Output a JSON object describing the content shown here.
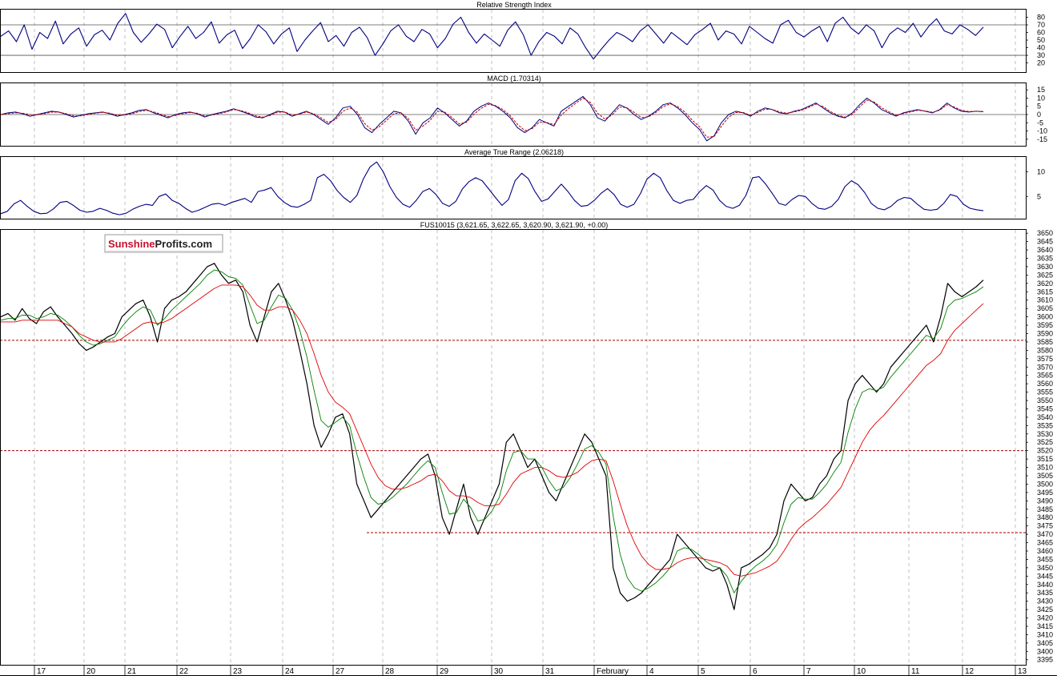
{
  "logo": {
    "part1": "Sunshine",
    "part2": "Profits.com"
  },
  "colors": {
    "rsi": "#000080",
    "macd": "#000080",
    "macd_signal": "#c00000",
    "atr": "#000080",
    "price": "#000000",
    "ma_short": "#008000",
    "ma_long": "#e00000",
    "level": "#a00000",
    "grid": "#bfbfbf",
    "frame": "#000000"
  },
  "chart_data": [
    {
      "type": "line",
      "title": "Relative Strength Index",
      "ylim": [
        8,
        90
      ],
      "yticks": [
        80,
        70,
        60,
        50,
        40,
        30,
        20
      ],
      "reference_lines": [
        70,
        30
      ],
      "series": [
        {
          "values": [
            55,
            62,
            48,
            70,
            38,
            60,
            52,
            75,
            45,
            58,
            66,
            42,
            57,
            63,
            50,
            72,
            85,
            60,
            47,
            58,
            71,
            64,
            40,
            55,
            68,
            52,
            60,
            74,
            46,
            57,
            63,
            39,
            52,
            70,
            61,
            45,
            58,
            66,
            35,
            50,
            62,
            73,
            48,
            56,
            42,
            60,
            67,
            53,
            30,
            45,
            62,
            70,
            55,
            48,
            64,
            58,
            40,
            52,
            71,
            80,
            60,
            46,
            58,
            50,
            42,
            63,
            74,
            57,
            30,
            48,
            60,
            55,
            45,
            66,
            58,
            40,
            25,
            38,
            50,
            60,
            55,
            48,
            62,
            70,
            58,
            46,
            60,
            52,
            44,
            57,
            64,
            72,
            50,
            62,
            58,
            45,
            68,
            60,
            52,
            46,
            70,
            76,
            60,
            54,
            62,
            68,
            48,
            72,
            80,
            66,
            58,
            70,
            62,
            40,
            58,
            66,
            60,
            72,
            54,
            68,
            78,
            62,
            58,
            70,
            64,
            56,
            67
          ]
        }
      ]
    },
    {
      "type": "line",
      "title": "MACD (1.70314)",
      "ylim": [
        -19,
        19
      ],
      "yticks": [
        15,
        10,
        5,
        0,
        -5,
        -10,
        -15
      ],
      "series": [
        {
          "values": [
            0,
            1,
            1.5,
            0.5,
            -1,
            0,
            1,
            2,
            1.5,
            0,
            -1.5,
            -0.5,
            0.5,
            1,
            1.5,
            0.5,
            -1,
            0,
            1,
            2.5,
            3,
            1,
            -0.5,
            -2,
            0,
            1,
            1.5,
            0.5,
            -1.5,
            0,
            1,
            2,
            3.5,
            2,
            0.5,
            -1.5,
            -2,
            0,
            2,
            1.5,
            -1,
            0.5,
            2,
            0,
            -3,
            -6,
            -2,
            4,
            5,
            0,
            -8,
            -11,
            -6,
            -2,
            2,
            1,
            -4,
            -12,
            -5,
            -2,
            4,
            1,
            -3,
            -7,
            -4,
            2,
            5,
            7,
            5,
            2,
            -2,
            -8,
            -11,
            -8,
            -3,
            -5,
            -7,
            2,
            5,
            8,
            11,
            6,
            -2,
            -4,
            1,
            6,
            4,
            0,
            -3,
            -1,
            2,
            6,
            7,
            4,
            0,
            -5,
            -9,
            -16,
            -13,
            -5,
            0,
            2,
            1,
            -1,
            2,
            4,
            3,
            1,
            0.5,
            2,
            3,
            5,
            7,
            4,
            1,
            -1,
            -2,
            1,
            6,
            10,
            7,
            3,
            1,
            -1,
            1,
            2,
            3,
            2,
            1,
            3,
            7,
            4,
            2,
            1.5,
            2,
            1.7
          ]
        },
        {
          "values": [
            0,
            0.5,
            1,
            0.8,
            0,
            -0.2,
            0.5,
            1.5,
            1.4,
            0.5,
            -0.8,
            -0.8,
            0,
            0.8,
            1.3,
            0.8,
            -0.4,
            -0.4,
            0.5,
            1.8,
            2.6,
            1.6,
            0.2,
            -1.2,
            -0.6,
            0.5,
            1.2,
            0.8,
            -0.8,
            -0.4,
            0.6,
            1.6,
            3,
            2.4,
            1,
            -0.8,
            -1.6,
            -0.6,
            1.4,
            1.5,
            -0.2,
            0.2,
            1.5,
            0.5,
            -2,
            -4.8,
            -3,
            2,
            4,
            1.4,
            -5.5,
            -9.5,
            -7.5,
            -3.5,
            0.5,
            1,
            -2.5,
            -9.5,
            -7,
            -3.5,
            2,
            1.4,
            -1.8,
            -5.8,
            -4.6,
            0.2,
            3.8,
            6.2,
            5.4,
            3,
            -0.8,
            -6,
            -9.8,
            -8.6,
            -4.6,
            -4.8,
            -6.2,
            -0.4,
            3.6,
            6.8,
            10,
            7.4,
            0.8,
            -2.8,
            -0.2,
            4.6,
            4.2,
            1.4,
            -1.8,
            -1.4,
            1.2,
            4.8,
            6.5,
            4.8,
            1.4,
            -3.4,
            -7.4,
            -13.8,
            -13.4,
            -7.2,
            -1.6,
            1.2,
            1.2,
            -0.4,
            1.2,
            3.2,
            3.1,
            1.6,
            0.8,
            1.6,
            2.6,
            4.4,
            6.4,
            4.8,
            1.8,
            -0.4,
            -1.6,
            0,
            4.6,
            8.8,
            7.6,
            4.2,
            1.8,
            -0.4,
            0.6,
            1.6,
            2.6,
            2.2,
            1.4,
            2.6,
            6,
            4.6,
            2.6,
            1.8,
            2,
            1.8
          ]
        }
      ]
    },
    {
      "type": "line",
      "title": "Average True Range (2.06218)",
      "ylim": [
        0.5,
        13
      ],
      "yticks": [
        10,
        5
      ],
      "series": [
        {
          "values": [
            1.5,
            2,
            3.5,
            4.2,
            3,
            2,
            1.5,
            1.6,
            2.5,
            3.8,
            4,
            3.2,
            2.2,
            1.8,
            2,
            2.6,
            2.2,
            1.6,
            1.3,
            1.6,
            2.4,
            3,
            3.4,
            3.2,
            5,
            5.5,
            4.2,
            3.6,
            2.6,
            1.8,
            2.2,
            2.8,
            3.4,
            3.6,
            3.2,
            3.8,
            4.2,
            4.6,
            3.8,
            6,
            6.3,
            6.8,
            5,
            3.8,
            3,
            2.8,
            3.4,
            4.2,
            8.8,
            9.5,
            8.2,
            6.2,
            4.8,
            3.8,
            5.2,
            8.6,
            11,
            12,
            10,
            7,
            4.8,
            3.4,
            2.8,
            4.2,
            6,
            6.6,
            5.4,
            3.6,
            3,
            4,
            6.5,
            8,
            8.8,
            8.2,
            6.5,
            4.8,
            3.2,
            4.4,
            8.2,
            9.7,
            8.6,
            6,
            4,
            4.5,
            6,
            7.5,
            6,
            4.2,
            3,
            3.2,
            4.2,
            5.6,
            6.6,
            5.4,
            3.4,
            2.8,
            3.4,
            5.6,
            8.5,
            9.7,
            8.8,
            6.2,
            4.2,
            3.6,
            4.2,
            4.4,
            6,
            7.2,
            6.3,
            4.2,
            3,
            2.6,
            3.2,
            5.2,
            8.8,
            9,
            7.5,
            5.6,
            3.6,
            3.2,
            4.4,
            5.2,
            5,
            3.6,
            2.6,
            2.4,
            3,
            4.4,
            7,
            8.2,
            7.4,
            5.8,
            3.6,
            2.6,
            2.3,
            3,
            4.2,
            4.8,
            4.6,
            3.4,
            2.4,
            2.2,
            2.4,
            3.6,
            5.4,
            5,
            3.4,
            2.6,
            2.3,
            2.1
          ]
        }
      ]
    },
    {
      "type": "line",
      "title": "FUS10015 (3,621.65, 3,622.65, 3,620.90, 3,621.90, +0.00)",
      "ylim": [
        3392,
        3652
      ],
      "yticks": [
        3650,
        3645,
        3640,
        3635,
        3630,
        3625,
        3620,
        3615,
        3610,
        3605,
        3600,
        3595,
        3590,
        3585,
        3580,
        3575,
        3570,
        3565,
        3560,
        3555,
        3550,
        3545,
        3540,
        3535,
        3530,
        3525,
        3520,
        3515,
        3510,
        3505,
        3500,
        3495,
        3490,
        3485,
        3480,
        3475,
        3470,
        3465,
        3460,
        3455,
        3450,
        3445,
        3440,
        3435,
        3430,
        3425,
        3420,
        3415,
        3410,
        3405,
        3400,
        3395
      ],
      "reference_lines": [
        3586,
        3520,
        3471
      ],
      "x_labels": [
        "17",
        "20",
        "21",
        "22",
        "23",
        "24",
        "27",
        "28",
        "29",
        "30",
        "31",
        "February",
        "4",
        "5",
        "6",
        "7",
        "10",
        "11",
        "12",
        "13"
      ],
      "series": [
        {
          "values": [
            3600,
            3602,
            3598,
            3605,
            3599,
            3596,
            3603,
            3606,
            3600,
            3595,
            3590,
            3584,
            3580,
            3582,
            3585,
            3588,
            3590,
            3600,
            3604,
            3608,
            3610,
            3600,
            3585,
            3605,
            3610,
            3612,
            3615,
            3620,
            3625,
            3630,
            3632,
            3625,
            3620,
            3622,
            3615,
            3595,
            3585,
            3600,
            3615,
            3620,
            3610,
            3598,
            3580,
            3560,
            3535,
            3522,
            3530,
            3540,
            3542,
            3530,
            3500,
            3490,
            3480,
            3485,
            3490,
            3495,
            3500,
            3505,
            3510,
            3515,
            3518,
            3505,
            3480,
            3470,
            3485,
            3500,
            3480,
            3470,
            3480,
            3490,
            3500,
            3525,
            3530,
            3520,
            3510,
            3515,
            3505,
            3495,
            3490,
            3500,
            3510,
            3520,
            3530,
            3525,
            3515,
            3505,
            3450,
            3435,
            3430,
            3432,
            3435,
            3440,
            3445,
            3450,
            3455,
            3470,
            3465,
            3460,
            3455,
            3450,
            3448,
            3450,
            3440,
            3425,
            3450,
            3452,
            3455,
            3458,
            3462,
            3470,
            3490,
            3500,
            3495,
            3490,
            3492,
            3500,
            3505,
            3515,
            3520,
            3550,
            3560,
            3565,
            3560,
            3555,
            3560,
            3570,
            3575,
            3580,
            3585,
            3590,
            3595,
            3585,
            3600,
            3620,
            3615,
            3612,
            3615,
            3618,
            3622
          ]
        },
        {
          "values": [
            3598,
            3599,
            3599,
            3601,
            3601,
            3599,
            3600,
            3602,
            3601,
            3598,
            3594,
            3589,
            3585,
            3583,
            3584,
            3586,
            3588,
            3594,
            3599,
            3603,
            3606,
            3604,
            3595,
            3599,
            3604,
            3608,
            3612,
            3616,
            3620,
            3625,
            3628,
            3627,
            3624,
            3623,
            3619,
            3607,
            3596,
            3598,
            3606,
            3613,
            3611,
            3604,
            3592,
            3576,
            3556,
            3538,
            3534,
            3537,
            3540,
            3535,
            3518,
            3504,
            3492,
            3488,
            3489,
            3492,
            3496,
            3500,
            3505,
            3510,
            3514,
            3510,
            3495,
            3482,
            3483,
            3491,
            3486,
            3478,
            3479,
            3484,
            3492,
            3508,
            3519,
            3520,
            3515,
            3515,
            3510,
            3502,
            3496,
            3498,
            3504,
            3512,
            3521,
            3523,
            3519,
            3512,
            3481,
            3458,
            3444,
            3438,
            3436,
            3438,
            3441,
            3445,
            3450,
            3460,
            3462,
            3461,
            3458,
            3454,
            3451,
            3450,
            3445,
            3435,
            3442,
            3447,
            3451,
            3454,
            3458,
            3464,
            3477,
            3488,
            3492,
            3491,
            3491,
            3495,
            3500,
            3507,
            3513,
            3531,
            3545,
            3555,
            3557,
            3556,
            3558,
            3564,
            3569,
            3574,
            3579,
            3584,
            3589,
            3587,
            3593,
            3606,
            3610,
            3611,
            3613,
            3615,
            3618
          ]
        },
        {
          "values": [
            3597,
            3597,
            3597,
            3598,
            3598,
            3598,
            3598,
            3598,
            3598,
            3596,
            3594,
            3590,
            3588,
            3586,
            3585,
            3585,
            3585,
            3587,
            3590,
            3593,
            3596,
            3597,
            3596,
            3597,
            3599,
            3602,
            3605,
            3608,
            3611,
            3614,
            3617,
            3619,
            3619,
            3619,
            3618,
            3613,
            3607,
            3604,
            3604,
            3606,
            3606,
            3604,
            3598,
            3590,
            3578,
            3565,
            3555,
            3549,
            3546,
            3542,
            3532,
            3522,
            3512,
            3504,
            3499,
            3497,
            3497,
            3498,
            3500,
            3502,
            3505,
            3506,
            3502,
            3496,
            3493,
            3493,
            3492,
            3489,
            3487,
            3487,
            3488,
            3494,
            3501,
            3506,
            3508,
            3510,
            3510,
            3508,
            3505,
            3504,
            3505,
            3507,
            3511,
            3514,
            3515,
            3514,
            3502,
            3488,
            3475,
            3465,
            3457,
            3452,
            3449,
            3449,
            3450,
            3453,
            3455,
            3456,
            3456,
            3455,
            3454,
            3453,
            3451,
            3446,
            3445,
            3446,
            3447,
            3449,
            3451,
            3454,
            3460,
            3467,
            3473,
            3477,
            3480,
            3484,
            3488,
            3493,
            3498,
            3507,
            3516,
            3525,
            3532,
            3537,
            3541,
            3546,
            3551,
            3556,
            3561,
            3566,
            3571,
            3574,
            3578,
            3586,
            3592,
            3596,
            3600,
            3604,
            3608
          ]
        }
      ]
    }
  ]
}
